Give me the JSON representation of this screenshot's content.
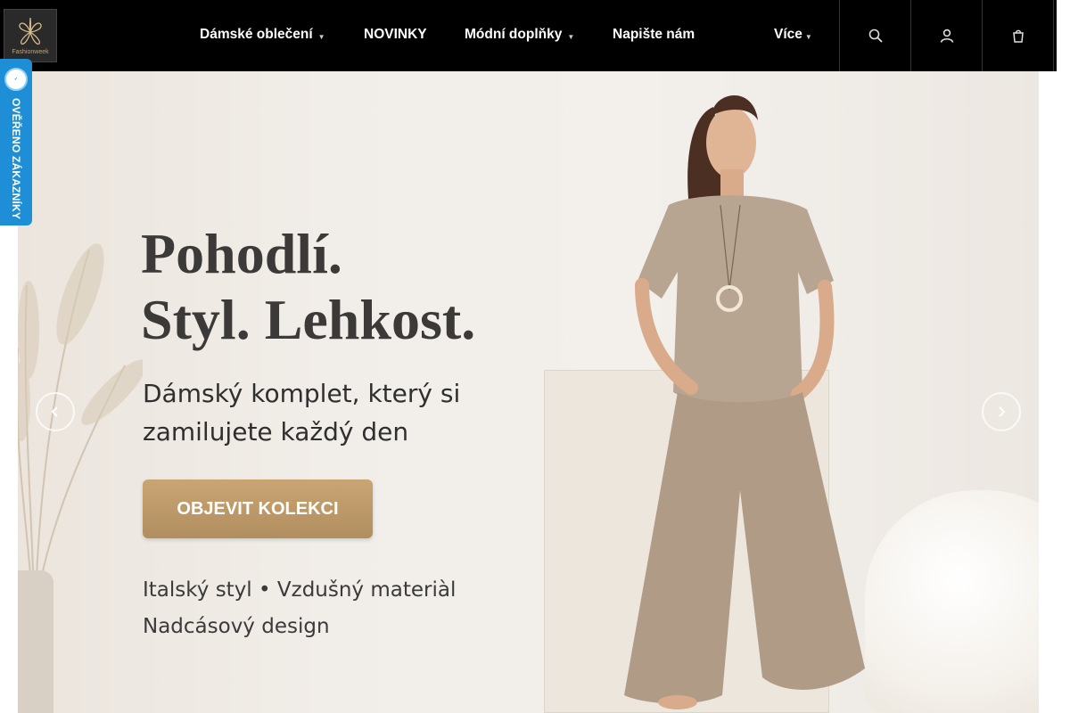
{
  "header": {
    "logo": {
      "icon": "flower-logo-icon",
      "text": "Fashionweek"
    },
    "nav": [
      {
        "label": "Dámské oblečení",
        "has_dropdown": true
      },
      {
        "label": "NOVINKY",
        "has_dropdown": false
      },
      {
        "label": "Módní doplňky",
        "has_dropdown": true
      },
      {
        "label": "Napište nám",
        "has_dropdown": false
      },
      {
        "label": "Více",
        "has_dropdown": true
      }
    ],
    "icons": [
      "search-icon",
      "user-icon",
      "cart-icon"
    ]
  },
  "badge": {
    "text": "OVĚŘENO ZÁKAZNÍKY",
    "icon": "verified-seal-icon",
    "color": "#1e8fd6"
  },
  "hero": {
    "headline_line1": "Pohodlí.",
    "headline_line2": "Styl. Lehkost.",
    "subline_line1": "Dámský komplet, který si",
    "subline_line2": "zamilujete každý den",
    "cta_label": "OBJEVIT KOLEKCI",
    "features_line1": "Italský styl • Vzdušný materiàl",
    "features_line2": "Nadcásový design",
    "prev_icon": "chevron-left-icon",
    "next_icon": "chevron-right-icon"
  },
  "colors": {
    "header_bg": "#000000",
    "cta_gold": "#c9a574",
    "outfit_taupe": "#b8a591"
  }
}
